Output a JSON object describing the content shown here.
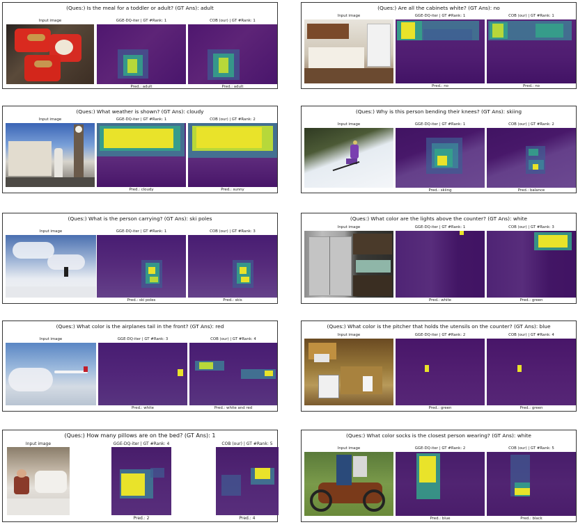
{
  "panels": [
    {
      "question": "(Ques:) Is the meal for a toddler or adult?  (GT Ans): adult",
      "input_label": "Input image",
      "m1_label": "GGE-DQ-iter | GT #Rank: 1",
      "m2_label": "COB (our) | GT #Rank: 1",
      "m1_pred": "Pred.: adult",
      "m2_pred": "Pred.: adult"
    },
    {
      "question": "(Ques:) Are all the cabinets white?  (GT Ans): no",
      "input_label": "Input image",
      "m1_label": "GGE-DQ-iter | GT #Rank: 1",
      "m2_label": "COB (our) | GT #Rank: 1",
      "m1_pred": "Pred.: no",
      "m2_pred": "Pred.: no"
    },
    {
      "question": "(Ques:) What weather is shown?  (GT Ans): cloudy",
      "input_label": "Input image",
      "m1_label": "GGE-DQ-iter | GT #Rank: 1",
      "m2_label": "COB (our) | GT #Rank: 2",
      "m1_pred": "Pred.: cloudy",
      "m2_pred": "Pred.: sunny"
    },
    {
      "question": "(Ques:) Why is this person bending their knees?  (GT Ans): skiing",
      "input_label": "Input image",
      "m1_label": "GGE-DQ-iter | GT #Rank: 1",
      "m2_label": "COB (our) | GT #Rank: 2",
      "m1_pred": "Pred.: skiing",
      "m2_pred": "Pred.: balance"
    },
    {
      "question": "(Ques:) What is the person carrying?  (GT Ans): ski poles",
      "input_label": "Input image",
      "m1_label": "GGE-DQ-iter | GT #Rank: 1",
      "m2_label": "COB (our) | GT #Rank: 3",
      "m1_pred": "Pred.: ski poles",
      "m2_pred": "Pred.: skis"
    },
    {
      "question": "(Ques:) What color are the lights above the counter?  (GT Ans): white",
      "input_label": "Input image",
      "m1_label": "GGE-DQ-iter | GT #Rank: 1",
      "m2_label": "COB (our) | GT #Rank: 3",
      "m1_pred": "Pred.: white",
      "m2_pred": "Pred.: green"
    },
    {
      "question": "(Ques:) What color is the airplanes tail in the front?  (GT Ans): red",
      "input_label": "Input image",
      "m1_label": "GGE-DQ-iter | GT #Rank: 3",
      "m2_label": "COB (our) | GT #Rank: 4",
      "m1_pred": "Pred.: white",
      "m2_pred": "Pred.: white and red"
    },
    {
      "question": "(Ques:) What color is the pitcher that holds the utensils on the counter?  (GT Ans): blue",
      "input_label": "Input image",
      "m1_label": "GGE-DQ-iter | GT #Rank: 2",
      "m2_label": "COB (our) | GT #Rank: 4",
      "m1_pred": "Pred.: green",
      "m2_pred": "Pred.: green"
    },
    {
      "question": "(Ques:) How many pillows are on the bed?  (GT Ans): 1",
      "input_label": "Input image",
      "m1_label": "GGE-DQ-iter | GT #Rank: 4",
      "m2_label": "COB (our) | GT #Rank: 5",
      "m1_pred": "Pred.: 2",
      "m2_pred": "Pred.: 4"
    },
    {
      "question": "(Ques:) What color socks is the closest person wearing?  (GT Ans): white",
      "input_label": "Input image",
      "m1_label": "GGE-DQ-iter | GT #Rank: 2",
      "m2_label": "COB (our) | GT #Rank: 5",
      "m1_pred": "Pred.: blue",
      "m2_pred": "Pred.: black"
    }
  ],
  "colors": {
    "heatmap_bg": "#46126b",
    "heatmap_hot": "#e9e32a",
    "heatmap_mid": "#34a48a",
    "border": "#333333"
  }
}
